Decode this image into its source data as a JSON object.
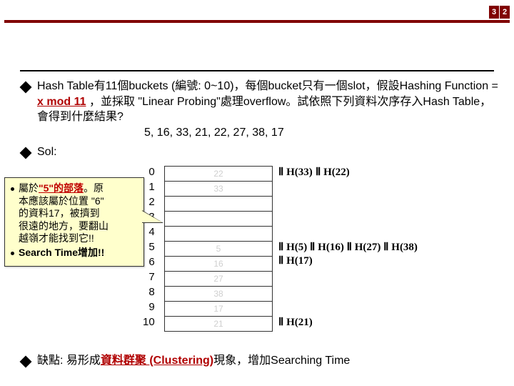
{
  "page_number": {
    "d1": "3",
    "d2": "2"
  },
  "bullet1": {
    "pre1": "Hash Table有11個buckets (編號: 0~10)，每個bucket只有一個slot，假設Hashing Function = ",
    "xmod": "x mod 11",
    "post1": "，並採取 \"Linear Probing\"處理overflow。試依照下列資料次序存入Hash Table，會得到什麼結果?",
    "sequence": "5, 16, 33, 21, 22, 27, 38, 17"
  },
  "sol_label": "Sol:",
  "indices": [
    "0",
    "1",
    "2",
    "3",
    "4",
    "5",
    "6",
    "7",
    "8",
    "9",
    "10"
  ],
  "cells": [
    "22",
    "33",
    "",
    "",
    "",
    "5",
    "16",
    "27",
    "38",
    "17",
    "21"
  ],
  "h_labels": {
    "r0a": "Ⅱ H(33)",
    "r0b": "Ⅱ H(22)",
    "r5a": "Ⅱ H(5) ",
    "r5b": "Ⅱ H(16) ",
    "r5c": "Ⅱ H(27) ",
    "r5d": "Ⅱ H(38)",
    "r6a": "Ⅱ H(17)",
    "r10a": "Ⅱ H(21)"
  },
  "callout": {
    "line1_pre": "屬於",
    "line1_red": "\"5\"的部落",
    "line1_post": "。原",
    "line2": "本應該屬於位置 \"6\"",
    "line3": "的資料17，被擠到",
    "line4": "很遠的地方，要翻山",
    "line5": "越嶺才能找到它!!",
    "line6": "Search Time增加!!"
  },
  "bottom": {
    "pre": "缺點: 易形成",
    "cluster": "資料群聚 (Clustering)",
    "post": "現象，增加Searching Time"
  }
}
